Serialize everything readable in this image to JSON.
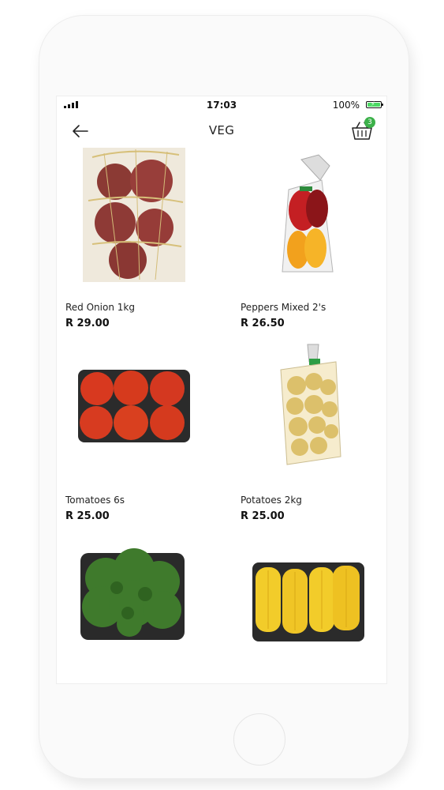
{
  "status": {
    "time": "17:03",
    "battery": "100%"
  },
  "header": {
    "title": "VEG",
    "cart_count": "3"
  },
  "products": [
    {
      "name": "Red Onion 1kg",
      "price": "R 29.00"
    },
    {
      "name": "Peppers Mixed 2's",
      "price": "R 26.50"
    },
    {
      "name": "Tomatoes 6s",
      "price": "R 25.00"
    },
    {
      "name": "Potatoes 2kg",
      "price": "R 25.00"
    },
    {
      "name": "",
      "price": ""
    },
    {
      "name": "",
      "price": ""
    }
  ],
  "colors": {
    "accent": "#3cb14a",
    "background": "#ffffff"
  }
}
